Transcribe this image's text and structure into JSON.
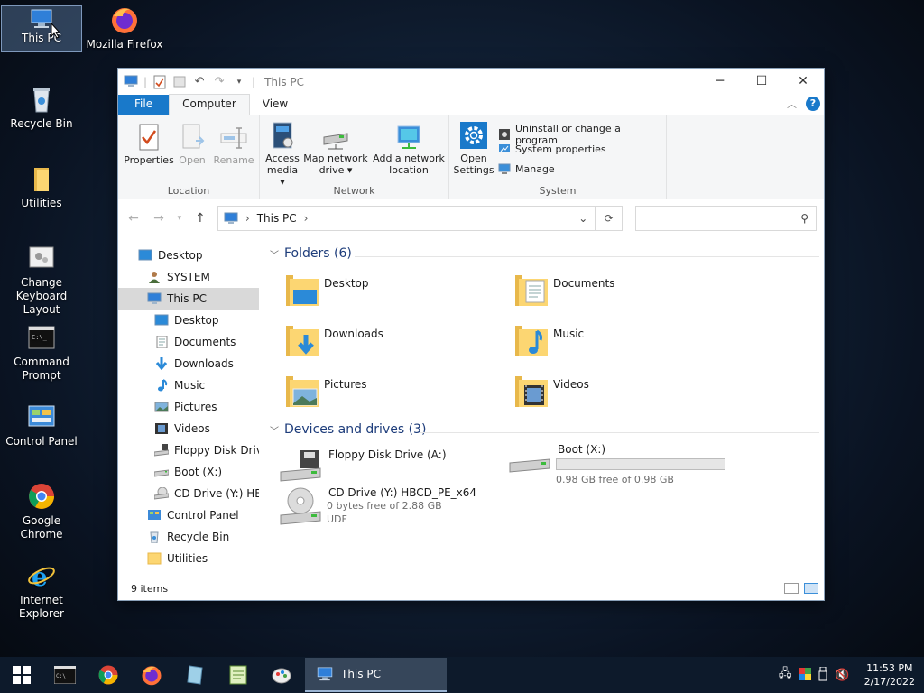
{
  "desktop": {
    "icons": [
      {
        "label": "This PC"
      },
      {
        "label": "Mozilla Firefox"
      },
      {
        "label": "Recycle Bin"
      },
      {
        "label": "Utilities"
      },
      {
        "label_line1": "Change",
        "label_line2": "Keyboard Layout"
      },
      {
        "label_line1": "Command",
        "label_line2": "Prompt"
      },
      {
        "label": "Control Panel"
      },
      {
        "label": "Google Chrome"
      },
      {
        "label": "Internet Explorer"
      }
    ]
  },
  "window": {
    "title": "This PC",
    "tabs": {
      "file": "File",
      "computer": "Computer",
      "view": "View"
    },
    "help": "?",
    "ribbon": {
      "location": {
        "label": "Location",
        "properties": "Properties",
        "open": "Open",
        "rename": "Rename"
      },
      "network": {
        "label": "Network",
        "access_media_l1": "Access",
        "access_media_l2": "media ▾",
        "map_drive_l1": "Map network",
        "map_drive_l2": "drive ▾",
        "add_location_l1": "Add a network",
        "add_location_l2": "location"
      },
      "system": {
        "label": "System",
        "open_settings_l1": "Open",
        "open_settings_l2": "Settings",
        "uninstall": "Uninstall or change a program",
        "system_properties": "System properties",
        "manage": "Manage"
      }
    },
    "address": {
      "path": "This PC",
      "search_placeholder": ""
    },
    "nav_pane": [
      {
        "label": "Desktop",
        "indent": 0,
        "icon": "desktop"
      },
      {
        "label": "SYSTEM",
        "indent": 1,
        "icon": "user"
      },
      {
        "label": "This PC",
        "indent": 1,
        "icon": "pc",
        "selected": true
      },
      {
        "label": "Desktop",
        "indent": 2,
        "icon": "desktop"
      },
      {
        "label": "Documents",
        "indent": 2,
        "icon": "documents"
      },
      {
        "label": "Downloads",
        "indent": 2,
        "icon": "downloads"
      },
      {
        "label": "Music",
        "indent": 2,
        "icon": "music"
      },
      {
        "label": "Pictures",
        "indent": 2,
        "icon": "pictures"
      },
      {
        "label": "Videos",
        "indent": 2,
        "icon": "videos"
      },
      {
        "label": "Floppy Disk Drive",
        "indent": 2,
        "icon": "floppy"
      },
      {
        "label": "Boot (X:)",
        "indent": 2,
        "icon": "drive"
      },
      {
        "label": "CD Drive (Y:) HBC",
        "indent": 2,
        "icon": "cd"
      },
      {
        "label": "Control Panel",
        "indent": 1,
        "icon": "control-panel"
      },
      {
        "label": "Recycle Bin",
        "indent": 1,
        "icon": "recycle"
      },
      {
        "label": "Utilities",
        "indent": 1,
        "icon": "folder"
      }
    ],
    "folders_header": "Folders (6)",
    "folders": [
      {
        "name": "Desktop",
        "icon": "desktop-folder"
      },
      {
        "name": "Documents",
        "icon": "documents-folder"
      },
      {
        "name": "Downloads",
        "icon": "downloads-folder"
      },
      {
        "name": "Music",
        "icon": "music-folder"
      },
      {
        "name": "Pictures",
        "icon": "pictures-folder"
      },
      {
        "name": "Videos",
        "icon": "videos-folder"
      }
    ],
    "devices_header": "Devices and drives (3)",
    "drives": {
      "floppy": {
        "name": "Floppy Disk Drive (A:)"
      },
      "boot": {
        "name": "Boot (X:)",
        "free": "0.98 GB free of 0.98 GB",
        "used_fraction": 0.0
      },
      "cd": {
        "name": "CD Drive (Y:) HBCD_PE_x64",
        "free": "0 bytes free of 2.88 GB",
        "fs": "UDF"
      }
    },
    "status": "9 items"
  },
  "taskbar": {
    "active_window": "This PC",
    "time": "11:53 PM",
    "date": "2/17/2022"
  },
  "colors": {
    "accent": "#1979ca",
    "section_header": "#1e3d7b",
    "folder_yellow": "#fcd672"
  }
}
